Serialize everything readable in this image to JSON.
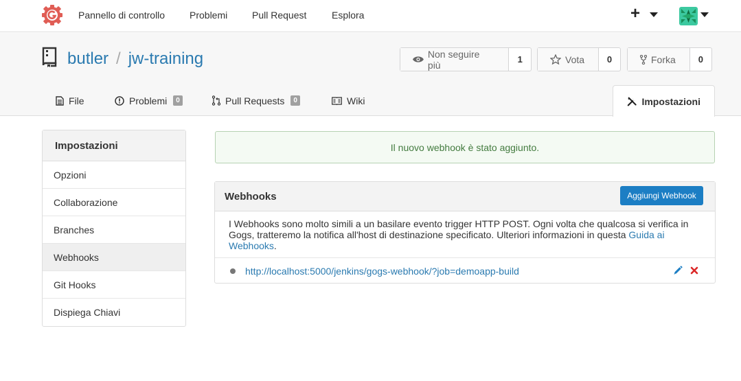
{
  "nav": {
    "items": [
      "Pannello di controllo",
      "Problemi",
      "Pull Request",
      "Esplora"
    ],
    "plus_symbol": "+"
  },
  "repo": {
    "owner": "butler",
    "separator": "/",
    "name": "jw-training",
    "watch": {
      "label": "Non seguire più",
      "count": "1"
    },
    "star": {
      "label": "Vota",
      "count": "0"
    },
    "fork": {
      "label": "Forka",
      "count": "0"
    }
  },
  "tabs": [
    {
      "label": "File",
      "icon": "file-icon"
    },
    {
      "label": "Problemi",
      "badge": "0",
      "icon": "issue-icon"
    },
    {
      "label": "Pull Requests",
      "badge": "0",
      "icon": "pull-request-icon"
    },
    {
      "label": "Wiki",
      "icon": "wiki-icon"
    },
    {
      "label": "Impostazioni",
      "icon": "tools-icon",
      "active": true
    }
  ],
  "sidebar": {
    "header": "Impostazioni",
    "items": [
      {
        "label": "Opzioni"
      },
      {
        "label": "Collaborazione"
      },
      {
        "label": "Branches"
      },
      {
        "label": "Webhooks",
        "active": true
      },
      {
        "label": "Git Hooks"
      },
      {
        "label": "Dispiega Chiavi"
      }
    ]
  },
  "alert": {
    "text": "Il nuovo webhook è stato aggiunto."
  },
  "webhooks": {
    "title": "Webhooks",
    "add_button": "Aggiungi Webhook",
    "description": "I Webhooks sono molto simili a un basilare evento trigger HTTP POST. Ogni volta che qualcosa si verifica in Gogs, tratteremo la notifica all'host di destinazione specificato. Ulteriori informazioni in questa ",
    "guide_link": "Guida ai Webhooks",
    "description_end": ".",
    "hooks": [
      {
        "url": "http://localhost:5000/jenkins/gogs-webhook/?job=demoapp-build"
      }
    ]
  },
  "colors": {
    "accent": "#1c7ec4",
    "link": "#2a7ab0",
    "success_text": "#437b3f",
    "delete": "#db2828",
    "logo": "#e05d55"
  }
}
